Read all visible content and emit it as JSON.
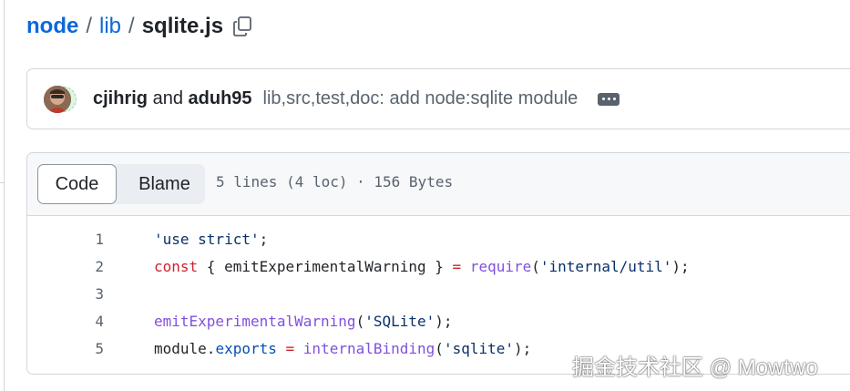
{
  "breadcrumb": {
    "repo": "node",
    "separator": "/",
    "dir": "lib",
    "file": "sqlite.js",
    "copy_icon": "copy-icon"
  },
  "commit": {
    "author1": "cjihrig",
    "and": "and",
    "author2": "aduh95",
    "message": "lib,src,test,doc: add node:sqlite module",
    "more_icon": "ellipsis-icon"
  },
  "file": {
    "tabs": {
      "code": "Code",
      "blame": "Blame"
    },
    "meta": "5 lines (4 loc) · 156 Bytes",
    "lines": [
      {
        "num": "1",
        "tokens": [
          {
            "t": "'use strict'",
            "c": "str"
          },
          {
            "t": ";",
            "c": ""
          }
        ]
      },
      {
        "num": "2",
        "tokens": [
          {
            "t": "const",
            "c": "kw"
          },
          {
            "t": " { emitExperimentalWarning } ",
            "c": ""
          },
          {
            "t": "=",
            "c": "kw"
          },
          {
            "t": " ",
            "c": ""
          },
          {
            "t": "require",
            "c": "fn"
          },
          {
            "t": "(",
            "c": ""
          },
          {
            "t": "'internal/util'",
            "c": "str"
          },
          {
            "t": ");",
            "c": ""
          }
        ]
      },
      {
        "num": "3",
        "tokens": []
      },
      {
        "num": "4",
        "tokens": [
          {
            "t": "emitExperimentalWarning",
            "c": "fn"
          },
          {
            "t": "(",
            "c": ""
          },
          {
            "t": "'SQLite'",
            "c": "str"
          },
          {
            "t": ");",
            "c": ""
          }
        ]
      },
      {
        "num": "5",
        "tokens": [
          {
            "t": "module",
            "c": ""
          },
          {
            "t": ".",
            "c": ""
          },
          {
            "t": "exports",
            "c": "prop"
          },
          {
            "t": " ",
            "c": ""
          },
          {
            "t": "=",
            "c": "kw"
          },
          {
            "t": " ",
            "c": ""
          },
          {
            "t": "internalBinding",
            "c": "fn"
          },
          {
            "t": "(",
            "c": ""
          },
          {
            "t": "'sqlite'",
            "c": "str"
          },
          {
            "t": ");",
            "c": ""
          }
        ]
      }
    ]
  },
  "watermark": "掘金技术社区 @ Mowtwo",
  "colors": {
    "link": "#0969da",
    "muted": "#59636e",
    "string": "#0a3069",
    "keyword": "#cf222e",
    "function": "#8250df",
    "property": "#0550ae"
  }
}
